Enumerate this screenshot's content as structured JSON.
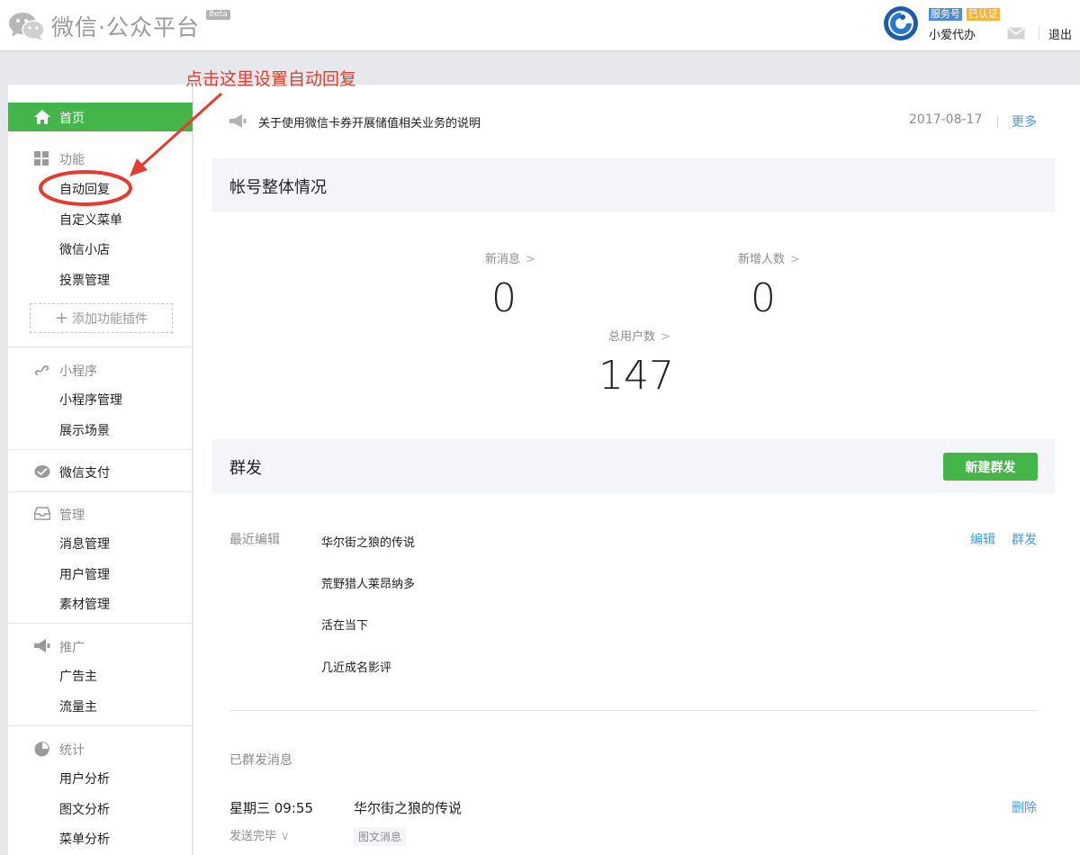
{
  "header": {
    "logo_text": "微信·公众平台",
    "beta": "Beta",
    "badge_service": "服务号",
    "badge_verified": "已认证",
    "account_name": "小爱代办",
    "logout": "退出"
  },
  "annotation": {
    "text": "点击这里设置自动回复",
    "color": "#e43c2f"
  },
  "sidebar": {
    "home": "首页",
    "groups": {
      "features": {
        "title": "功能",
        "items": [
          "自动回复",
          "自定义菜单",
          "微信小店",
          "投票管理"
        ],
        "add_plugin": "添加功能插件"
      },
      "miniprogram": {
        "title": "小程序",
        "items": [
          "小程序管理",
          "展示场景"
        ]
      },
      "pay": {
        "title": "微信支付"
      },
      "manage": {
        "title": "管理",
        "items": [
          "消息管理",
          "用户管理",
          "素材管理"
        ]
      },
      "promote": {
        "title": "推广",
        "items": [
          "广告主",
          "流量主"
        ]
      },
      "stats": {
        "title": "统计",
        "items": [
          "用户分析",
          "图文分析",
          "菜单分析"
        ]
      }
    }
  },
  "main": {
    "notice": {
      "text": "关于使用微信卡券开展储值相关业务的说明",
      "date": "2017-08-17",
      "more": "更多"
    },
    "overview": {
      "title": "帐号整体情况",
      "new_messages_label": "新消息",
      "new_messages_value": "0",
      "new_users_label": "新增人数",
      "new_users_value": "0",
      "total_users_label": "总用户数",
      "total_users_value": "147"
    },
    "mass": {
      "title": "群发",
      "new_button": "新建群发",
      "recent_label": "最近编辑",
      "recent_items": [
        "华尔街之狼的传说",
        "荒野猎人莱昂纳多",
        "活在当下",
        "几近成名影评"
      ],
      "edit": "编辑",
      "send": "群发",
      "sent_label": "已群发消息",
      "sent": {
        "time": "星期三 09:55",
        "title": "华尔街之狼的传说",
        "status": "发送完毕",
        "tag": "图文消息",
        "delete": "删除"
      }
    }
  },
  "colors": {
    "accent_green": "#44b549",
    "link_blue": "#459ae9",
    "annotation_red": "#e43c2f"
  }
}
